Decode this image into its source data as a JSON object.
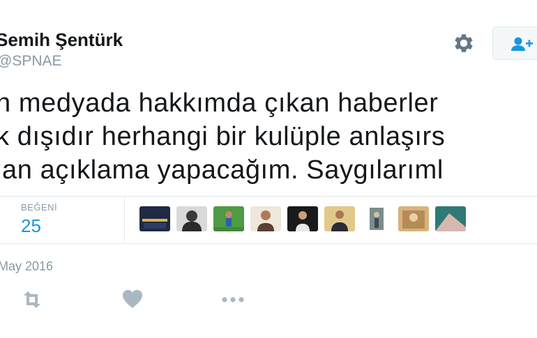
{
  "tweet": {
    "author_name": "Semih Şentürk",
    "author_handle": "@SPNAE",
    "text_lines": [
      "n medyada hakkımda çıkan haberler",
      "k dışıdır herhangi bir kulüple anlaşırs",
      "lan açıklama yapacağım. Saygılarıml"
    ],
    "likes_label": "BEĞENİ",
    "likes_count": "25",
    "date": "May 2016"
  },
  "header": {
    "icons": [
      "gear-icon",
      "follow-user-icon"
    ]
  },
  "liker_avatars": [
    {
      "name": "avatar-1",
      "bg": "#1f2a44"
    },
    {
      "name": "avatar-2",
      "bg": "#3a3a3a"
    },
    {
      "name": "avatar-3",
      "bg": "#3f8a3a"
    },
    {
      "name": "avatar-4",
      "bg": "#5b4033"
    },
    {
      "name": "avatar-5",
      "bg": "#1a1a1a"
    },
    {
      "name": "avatar-6",
      "bg": "#c9a14a"
    },
    {
      "name": "avatar-7",
      "bg": "#7c8c8c"
    },
    {
      "name": "avatar-8",
      "bg": "#b58b56"
    },
    {
      "name": "avatar-9",
      "bg": "#2f7a76"
    }
  ],
  "actions": [
    "retweet-icon",
    "like-heart-icon",
    "more-icon"
  ],
  "colors": {
    "accent": "#1b95e0",
    "muted": "#8899a6",
    "icon": "#657786",
    "icon_light": "#aab8c2",
    "border": "#e1e8ed"
  }
}
